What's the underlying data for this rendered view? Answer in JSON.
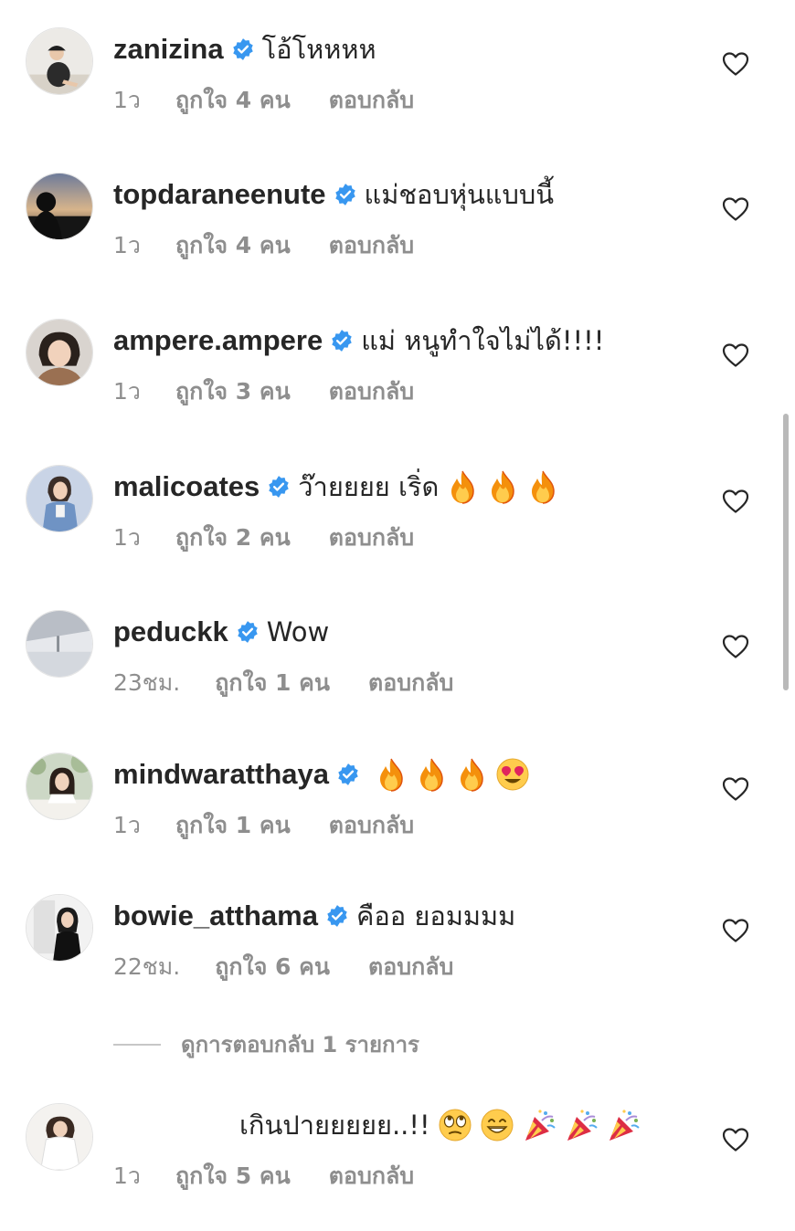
{
  "comments": [
    {
      "username": "zanizina",
      "text": "โอ้โหหหห",
      "emojis": [],
      "time": "1ว",
      "likes": "ถูกใจ 4 คน",
      "reply": "ตอบกลับ",
      "avatar": "girl-cap-avatar"
    },
    {
      "username": "topdaraneenute",
      "text": "แม่ชอบหุ่นแบบนี้",
      "emojis": [],
      "time": "1ว",
      "likes": "ถูกใจ 4 คน",
      "reply": "ตอบกลับ",
      "avatar": "sunset-silhouette-avatar"
    },
    {
      "username": "ampere.ampere",
      "text": "แม่ หนูทำใจไม่ได้!!!!",
      "emojis": [],
      "time": "1ว",
      "likes": "ถูกใจ 3 คน",
      "reply": "ตอบกลับ",
      "avatar": "short-hair-avatar"
    },
    {
      "username": "malicoates",
      "text": "ว๊ายยยย เริ่ด",
      "emojis": [
        "fire",
        "fire",
        "fire"
      ],
      "time": "1ว",
      "likes": "ถูกใจ 2 คน",
      "reply": "ตอบกลับ",
      "avatar": "denim-girl-avatar"
    },
    {
      "username": "peduckk",
      "text": "Wow",
      "emojis": [],
      "time": "23ชม.",
      "likes": "ถูกใจ 1 คน",
      "reply": "ตอบกลับ",
      "avatar": "grey-room-avatar"
    },
    {
      "username": "mindwaratthaya",
      "text": "",
      "emojis": [
        "fire",
        "fire",
        "fire",
        "heart-eyes"
      ],
      "time": "1ว",
      "likes": "ถูกใจ 1 คน",
      "reply": "ตอบกลับ",
      "avatar": "table-girl-avatar"
    },
    {
      "username": "bowie_atthama",
      "text": "คืออ ยอมมมม",
      "emojis": [],
      "time": "22ชม.",
      "likes": "ถูกใจ 6 คน",
      "reply": "ตอบกลับ",
      "avatar": "mirror-girl-avatar"
    },
    {
      "username": "",
      "text": "เกินปายยยยย..!!",
      "emojis": [
        "rolling-eyes",
        "grin",
        "party-popper",
        "party-popper",
        "party-popper"
      ],
      "time": "1ว",
      "likes": "ถูกใจ 5 คน",
      "reply": "ตอบกลับ",
      "avatar": "white-dress-avatar"
    }
  ],
  "view_replies": "ดูการตอบกลับ 1 รายการ",
  "colors": {
    "text": "#262626",
    "meta": "#8e8e8e",
    "verified": "#3897f0"
  }
}
